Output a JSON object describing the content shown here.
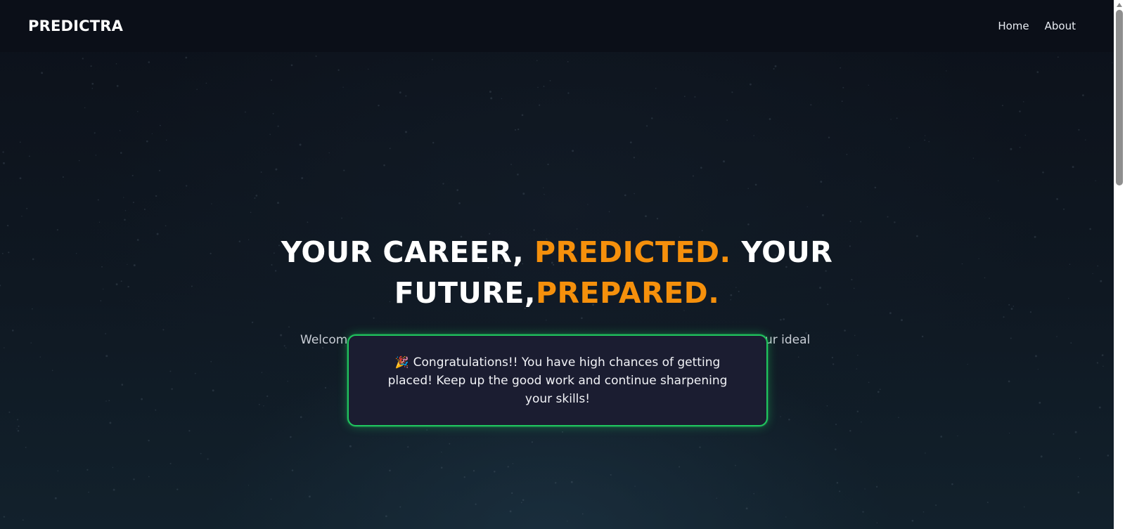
{
  "navbar": {
    "logo": "PREDICTRA",
    "links": [
      "Home",
      "About"
    ]
  },
  "hero": {
    "line1_white_a": "YOUR CAREER, ",
    "line1_accent": "PREDICTED.",
    "line1_white_b": " YOUR",
    "line2_white": "FUTURE,",
    "line2_accent": "PREPARED.",
    "subtitle_visible_left": "Welcom",
    "subtitle_visible_right": "ur ideal"
  },
  "toast": {
    "icon": "party-popper-icon",
    "icon_glyph": "🎉",
    "message": "Congratulations!! You have high chances of getting placed! Keep up the good work and continue sharpening your skills!"
  },
  "colors": {
    "accent": "#f5900c",
    "toast_border": "#20c55e",
    "toast_bg": "#1b1d31",
    "navbar_bg": "#0b0f18"
  }
}
